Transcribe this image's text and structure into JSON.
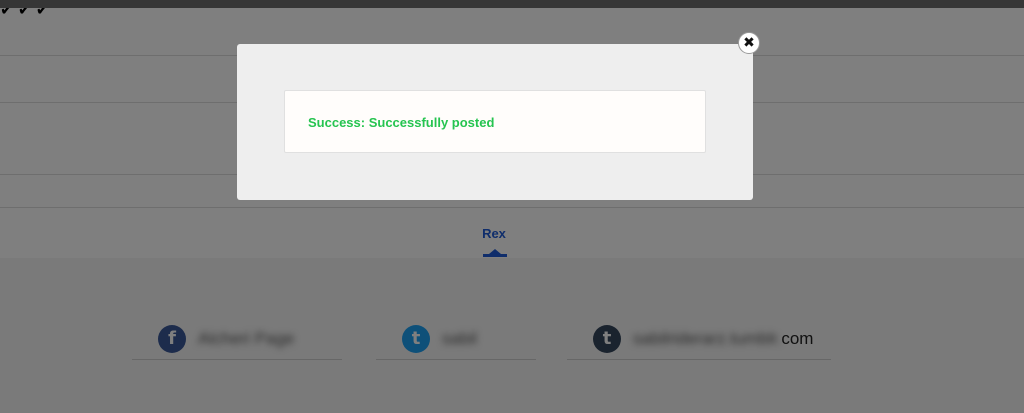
{
  "background": {
    "active_tab": "Rex",
    "accounts": [
      {
        "network": "facebook",
        "icon": "facebook-icon",
        "glyph": "f",
        "color": "#3b5998",
        "name": "Alcheri Page",
        "suffix": "",
        "posted": true
      },
      {
        "network": "twitter",
        "icon": "twitter-icon",
        "glyph": "t",
        "color": "#1da1f2",
        "name": "sabil",
        "suffix": "",
        "posted": true
      },
      {
        "network": "tumblr",
        "icon": "tumblr-icon",
        "glyph": "t",
        "color": "#35465c",
        "name": "sabilriderarz.tumblr.",
        "suffix": "com",
        "posted": true
      }
    ],
    "check_glyph": "✔"
  },
  "modal": {
    "message": "Success: Successfully posted",
    "message_color": "#26c450",
    "close_glyph": "✖"
  }
}
